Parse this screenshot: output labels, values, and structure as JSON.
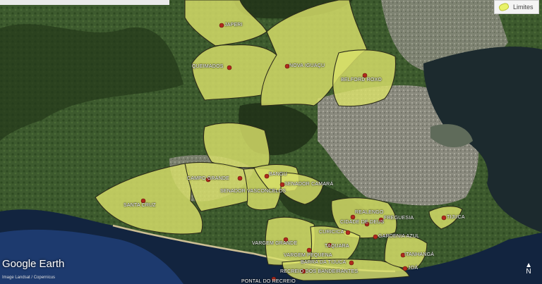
{
  "legend": {
    "label": "Limites",
    "swatch_color": "#e8f26a"
  },
  "branding": {
    "name": "Google Earth",
    "attribution": "Image Landsat / Copernicus"
  },
  "compass": {
    "label": "N"
  },
  "colors": {
    "region_fill": "#d9e06a",
    "region_border": "#2b2b1a",
    "marker": "#b02a1e"
  },
  "places": [
    {
      "name": "JAPERI"
    },
    {
      "name": "QUEIMADOS"
    },
    {
      "name": "NOVA IGUAÇU"
    },
    {
      "name": "BELFORD ROXO"
    },
    {
      "name": "SANTA CRUZ"
    },
    {
      "name": "CAMPO GRANDE"
    },
    {
      "name": "SENADOR VASCONCELOS"
    },
    {
      "name": "BANGU"
    },
    {
      "name": "SENADOR CAMARÁ"
    },
    {
      "name": "REALENGO"
    },
    {
      "name": "CIDADE DE DEUS"
    },
    {
      "name": "FREGUESIA"
    },
    {
      "name": "CURICICA"
    },
    {
      "name": "GARDENIA AZUL"
    },
    {
      "name": "TAQUARA"
    },
    {
      "name": "VARGEM GRANDE"
    },
    {
      "name": "VARGEM PEQUENA"
    },
    {
      "name": "ITANHANGÁ"
    },
    {
      "name": "BARRA DA TIJUCA"
    },
    {
      "name": "RECREIO DOS BANDEIRANTES"
    },
    {
      "name": "JOÁ"
    },
    {
      "name": "PONTAL DO RECREIO"
    },
    {
      "name": "TIJUCA"
    }
  ]
}
